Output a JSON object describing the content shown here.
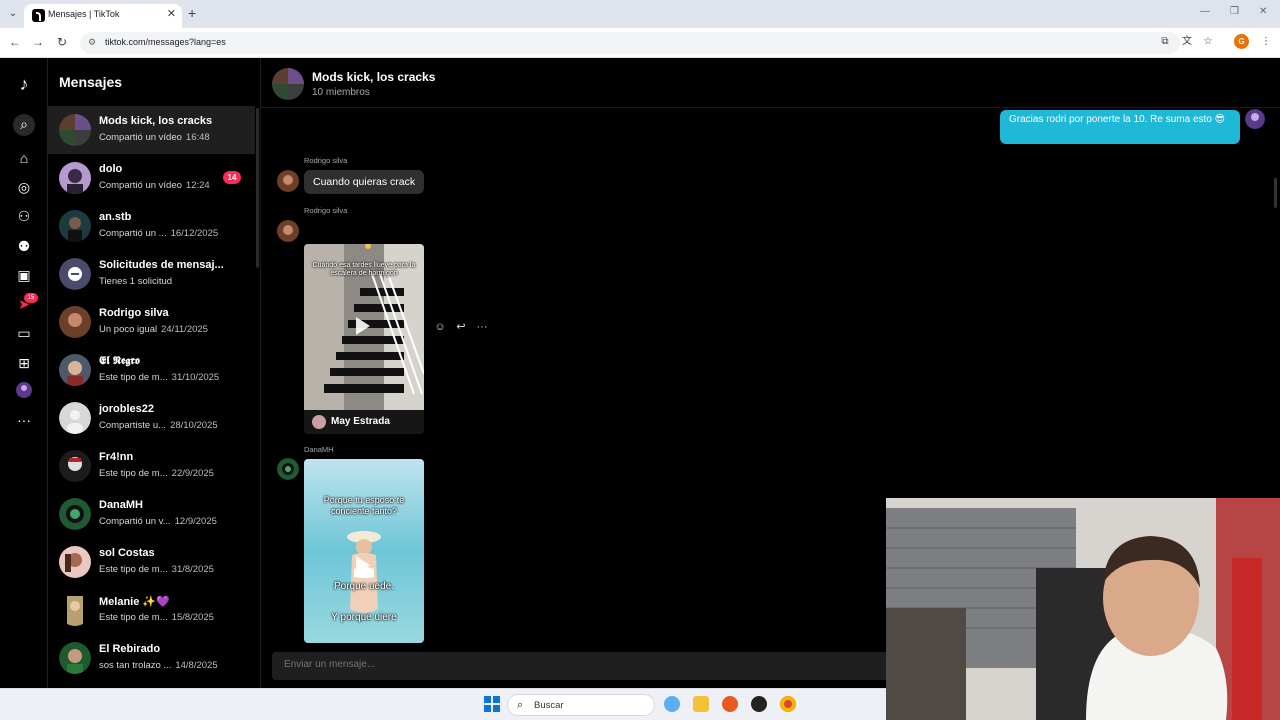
{
  "browser": {
    "tab_title": "Mensajes | TikTok",
    "url": "tiktok.com/messages?lang=es",
    "profile_initial": "G"
  },
  "sidebar": {
    "title": "Mensajes",
    "badge_count": "15"
  },
  "conversations": [
    {
      "name": "Mods kick, los cracks",
      "preview": "Compartió un vídeo",
      "time": "16:48",
      "active": true
    },
    {
      "name": "dolo",
      "preview": "Compartió un vídeo",
      "time": "12:24",
      "unread": "14"
    },
    {
      "name": "an.stb",
      "preview": "Compartió un ...",
      "time": "16/12/2025"
    },
    {
      "name": "Solicitudes de mensaj...",
      "preview": "Tienes 1 solicitud",
      "time": ""
    },
    {
      "name": "Rodrigo silva",
      "preview": "Un poco igual",
      "time": "24/11/2025"
    },
    {
      "name": "𝕰𝖑 𝕹𝖊𝖌𝖗𝖔",
      "preview": "Este tipo de m...",
      "time": "31/10/2025"
    },
    {
      "name": "jorobles22",
      "preview": "Compartiste u...",
      "time": "28/10/2025"
    },
    {
      "name": "Fr4!nn",
      "preview": "Este tipo de m...",
      "time": "22/9/2025"
    },
    {
      "name": "DanaMH",
      "preview": "Compartió un v...",
      "time": "12/9/2025"
    },
    {
      "name": "sol Costas",
      "preview": "Este tipo de m...",
      "time": "31/8/2025"
    },
    {
      "name": "Melanie ✨💜",
      "preview": "Este tipo de m...",
      "time": "15/8/2025"
    },
    {
      "name": "El Rebirado",
      "preview": "sos tan trolazo ...",
      "time": "14/8/2025"
    }
  ],
  "chat": {
    "group_name": "Mods kick, los cracks",
    "members": "10 miembros",
    "own_message": "Gracias rodri por ponerte la 10. Re suma esto 😎",
    "messages": [
      {
        "sender": "Rodrigo silva",
        "text": "Cuando quieras crack"
      },
      {
        "sender": "Rodrigo silva",
        "video_caption": "Cuando esa tardes llueve para la escalera de hormigón",
        "video_author": "May Estrada"
      },
      {
        "sender": "DanaMH",
        "video_caption_top": "Porque tu esposo te concientе tanto?",
        "video_caption_mid": "Porque      uede.",
        "video_caption_bot": "Y porque      uiere"
      }
    ],
    "composer_placeholder": "Enviar un mensaje..."
  },
  "taskbar": {
    "search_placeholder": "Buscar"
  }
}
